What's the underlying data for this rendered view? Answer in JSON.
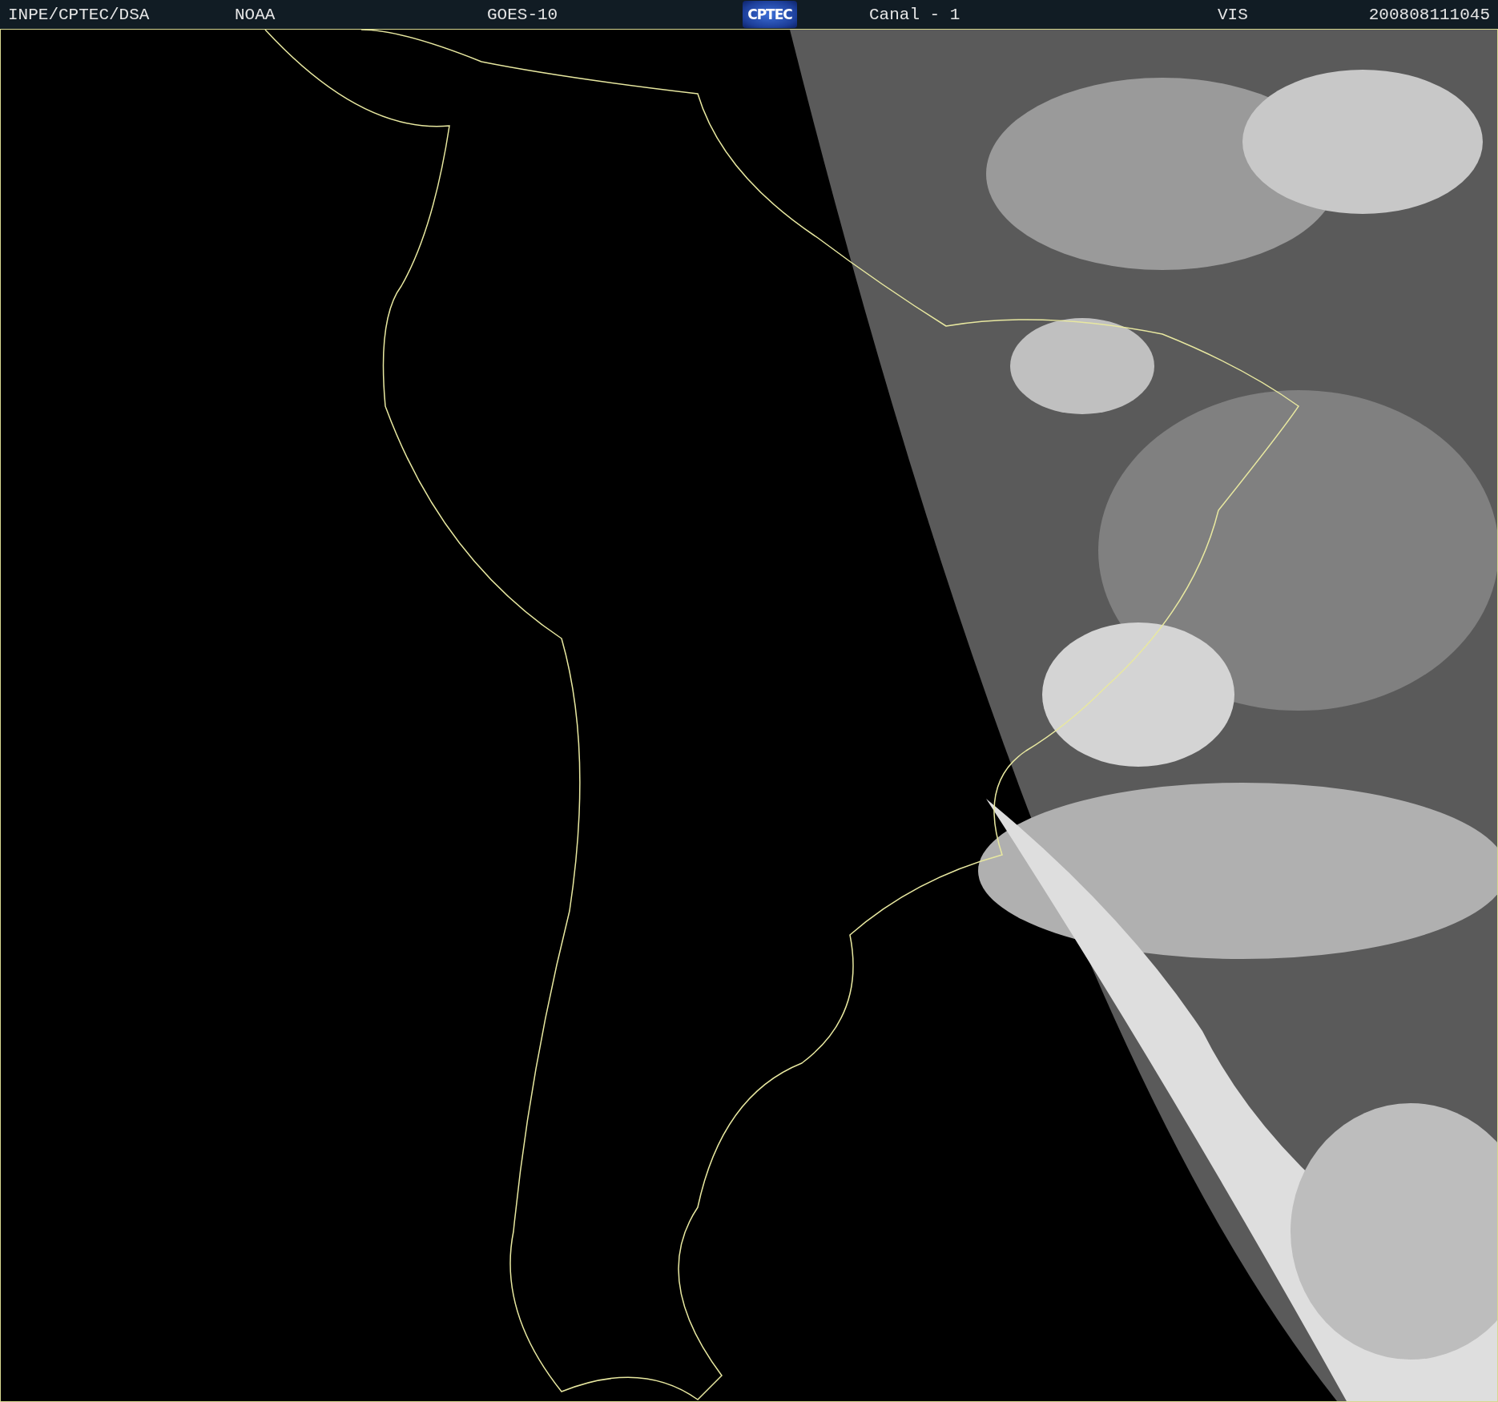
{
  "header": {
    "labels": [
      {
        "kind": "text",
        "text": "INPE/CPTEC/DSA"
      },
      {
        "kind": "text",
        "text": "NOAA"
      },
      {
        "kind": "text",
        "text": "GOES-10"
      },
      {
        "kind": "logo",
        "text": "CPTEC"
      },
      {
        "kind": "text",
        "text": "Canal - 1"
      },
      {
        "kind": "text",
        "text": "VIS"
      },
      {
        "kind": "text",
        "text": "200808111045"
      }
    ]
  }
}
